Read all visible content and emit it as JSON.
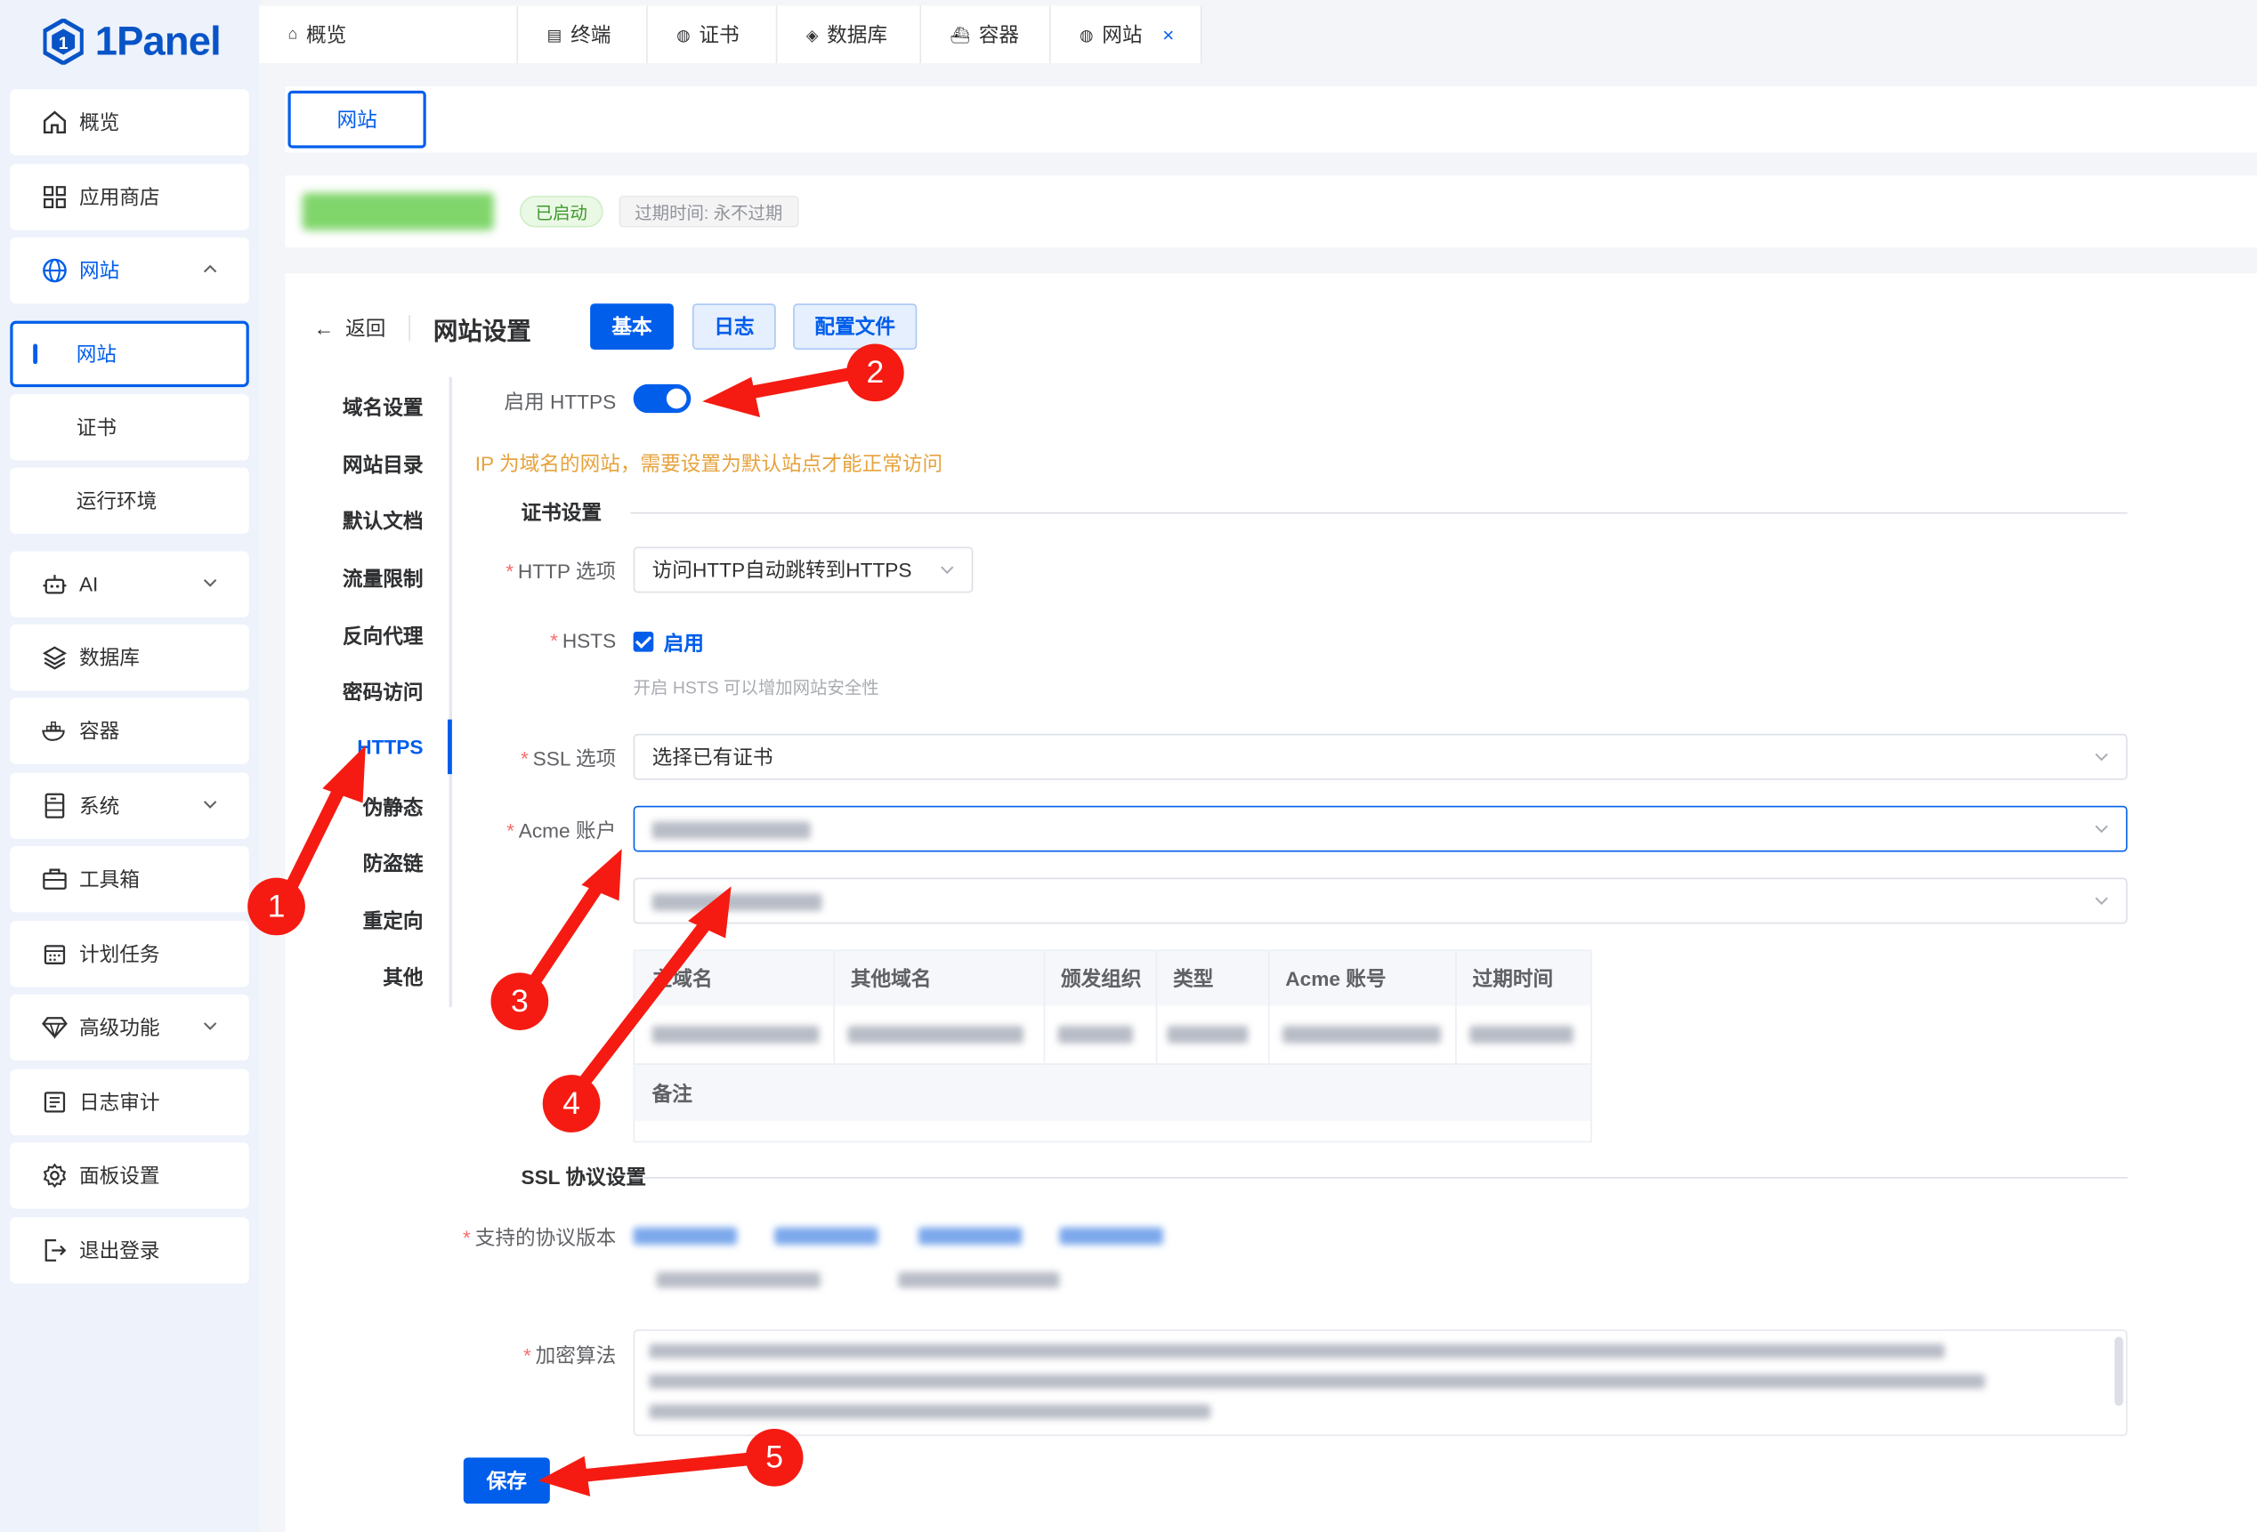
{
  "brand": {
    "logo_text": "1Panel"
  },
  "sidebar": {
    "items": [
      {
        "label": "概览",
        "icon": "home-icon"
      },
      {
        "label": "应用商店",
        "icon": "grid-icon"
      },
      {
        "label": "网站",
        "icon": "globe-icon"
      },
      {
        "label": "网站",
        "icon": ""
      },
      {
        "label": "证书",
        "icon": ""
      },
      {
        "label": "运行环境",
        "icon": ""
      },
      {
        "label": "AI",
        "icon": "robot-icon"
      },
      {
        "label": "数据库",
        "icon": "layers-icon"
      },
      {
        "label": "容器",
        "icon": "docker-icon"
      },
      {
        "label": "系统",
        "icon": "server-icon"
      },
      {
        "label": "工具箱",
        "icon": "toolbox-icon"
      },
      {
        "label": "计划任务",
        "icon": "calendar-icon"
      },
      {
        "label": "高级功能",
        "icon": "diamond-icon"
      },
      {
        "label": "日志审计",
        "icon": "log-icon"
      },
      {
        "label": "面板设置",
        "icon": "gear-icon"
      },
      {
        "label": "退出登录",
        "icon": "logout-icon"
      }
    ]
  },
  "tabs": [
    {
      "label": "概览"
    },
    {
      "label": "终端"
    },
    {
      "label": "证书"
    },
    {
      "label": "数据库"
    },
    {
      "label": "容器"
    },
    {
      "label": "网站",
      "close": "×"
    }
  ],
  "crumb": {
    "label": "网站"
  },
  "info": {
    "status": "已启动",
    "expire": "过期时间: 永不过期"
  },
  "header": {
    "back": "返回",
    "title": "网站设置",
    "btn_basic": "基本",
    "btn_log": "日志",
    "btn_config": "配置文件"
  },
  "leftnav": [
    "域名设置",
    "网站目录",
    "默认文档",
    "流量限制",
    "反向代理",
    "密码访问",
    "HTTPS",
    "伪静态",
    "防盗链",
    "重定向",
    "其他"
  ],
  "form": {
    "enable_https_label": "启用 HTTPS",
    "warning": "IP 为域名的网站，需要设置为默认站点才能正常访问",
    "cert_section": "证书设置",
    "http_option_label": "HTTP 选项",
    "http_option_value": "访问HTTP自动跳转到HTTPS",
    "hsts_label": "HSTS",
    "hsts_value": "启用",
    "hsts_hint": "开启 HSTS 可以增加网站安全性",
    "ssl_option_label": "SSL 选项",
    "ssl_option_value": "选择已有证书",
    "acme_label": "Acme 账户",
    "table_headers": [
      "主域名",
      "其他域名",
      "颁发组织",
      "类型",
      "Acme 账号",
      "过期时间"
    ],
    "remark_label": "备注",
    "ssl_protocol_section": "SSL 协议设置",
    "protocol_label": "支持的协议版本",
    "cipher_label": "加密算法",
    "save": "保存"
  },
  "annotations": [
    "1",
    "2",
    "3",
    "4",
    "5"
  ],
  "colors": {
    "primary": "#005eeb",
    "arrow": "#f51b12",
    "warning": "#e6a23c"
  }
}
